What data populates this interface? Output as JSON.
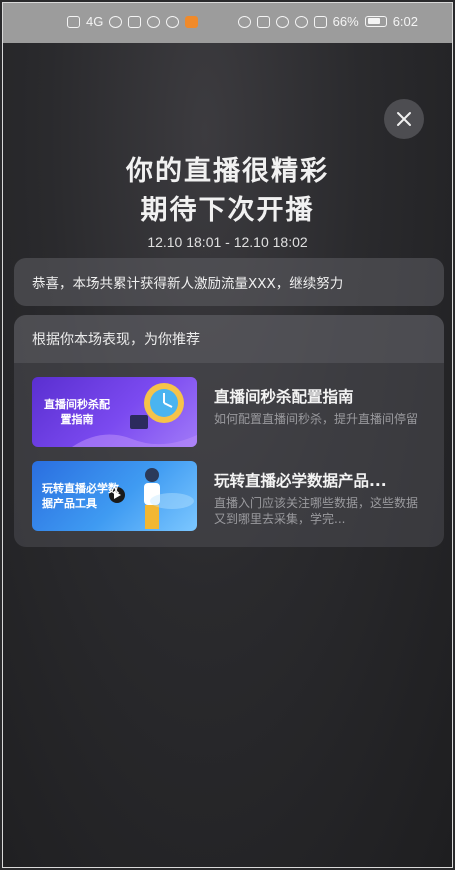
{
  "status_bar": {
    "battery_pct": "66%",
    "time": "6:02",
    "signal_label": "4G"
  },
  "close_icon": "close-icon",
  "title_line1": "你的直播很精彩",
  "title_line2": "期待下次开播",
  "time_range": "12.10 18:01 - 12.10 18:02",
  "congrats_text": "恭喜，本场共累计获得新人激励流量XXX，继续努力",
  "recommend": {
    "header": "根据你本场表现，为你推荐",
    "items": [
      {
        "thumb_text": "直播间秒杀配置指南",
        "title": "直播间秒杀配置指南",
        "desc": "如何配置直播间秒杀，提升直播间停留"
      },
      {
        "thumb_text": "玩转直播必学数据产品工具",
        "title": "玩转直播必学数据产品...",
        "desc": "直播入门应该关注哪些数据，这些数据又到哪里去采集，学完..."
      }
    ]
  }
}
